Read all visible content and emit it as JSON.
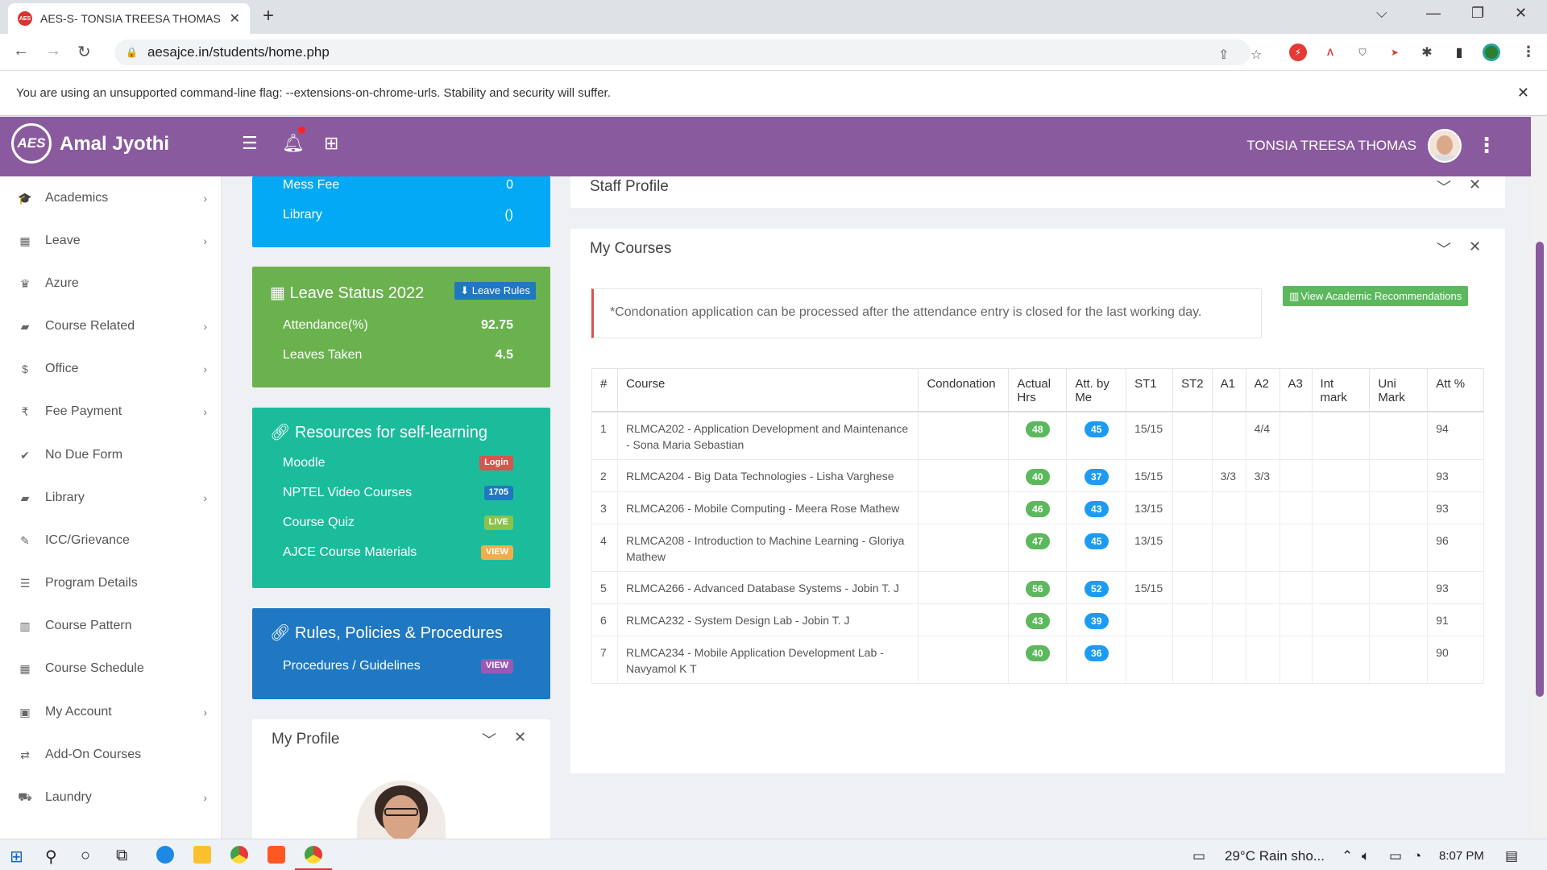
{
  "browser": {
    "tab_title": "AES-S- TONSIA TREESA THOMAS",
    "favicon_text": "AES",
    "url": "aesajce.in/students/home.php",
    "infobar_text": "You are using an unsupported command-line flag: --extensions-on-chrome-urls. Stability and security will suffer."
  },
  "header": {
    "logo_text": "AES",
    "brand": "Amal Jyothi",
    "username": "TONSIA TREESA THOMAS"
  },
  "sidebar": {
    "items": [
      {
        "label": "Academics",
        "icon": "graduation-cap-icon",
        "glyph": "🎓",
        "has_children": true
      },
      {
        "label": "Leave",
        "icon": "calendar-icon",
        "glyph": "▦",
        "has_children": true
      },
      {
        "label": "Azure",
        "icon": "crown-icon",
        "glyph": "♛",
        "has_children": false
      },
      {
        "label": "Course Related",
        "icon": "book-icon",
        "glyph": "▰",
        "has_children": true
      },
      {
        "label": "Office",
        "icon": "dollar-icon",
        "glyph": "$",
        "has_children": true
      },
      {
        "label": "Fee Payment",
        "icon": "rupee-icon",
        "glyph": "₹",
        "has_children": true
      },
      {
        "label": "No Due Form",
        "icon": "check-icon",
        "glyph": "✔",
        "has_children": false
      },
      {
        "label": "Library",
        "icon": "book-icon",
        "glyph": "▰",
        "has_children": true
      },
      {
        "label": "ICC/Grievance",
        "icon": "pencil-icon",
        "glyph": "✎",
        "has_children": false
      },
      {
        "label": "Program Details",
        "icon": "list-icon",
        "glyph": "☰",
        "has_children": false
      },
      {
        "label": "Course Pattern",
        "icon": "bar-chart-icon",
        "glyph": "▥",
        "has_children": false
      },
      {
        "label": "Course Schedule",
        "icon": "calendar-icon",
        "glyph": "▦",
        "has_children": false
      },
      {
        "label": "My Account",
        "icon": "id-card-icon",
        "glyph": "▣",
        "has_children": true
      },
      {
        "label": "Add-On Courses",
        "icon": "shuffle-icon",
        "glyph": "⇄",
        "has_children": false
      },
      {
        "label": "Laundry",
        "icon": "cart-icon",
        "glyph": "⛟",
        "has_children": true
      }
    ]
  },
  "fees": {
    "rows": [
      {
        "label": "Mess Fee",
        "value": "0"
      },
      {
        "label": "Library",
        "value": "()"
      }
    ]
  },
  "leave_status": {
    "title": "Leave Status 2022",
    "rules_button": "Leave Rules",
    "rows": [
      {
        "label": "Attendance(%)",
        "value": "92.75"
      },
      {
        "label": "Leaves Taken",
        "value": "4.5"
      }
    ]
  },
  "resources": {
    "title": "Resources for self-learning",
    "rows": [
      {
        "label": "Moodle",
        "badge": "Login",
        "badge_color": "#d9534f"
      },
      {
        "label": "NPTEL Video Courses",
        "badge": "1705",
        "badge_color": "#1f78c1"
      },
      {
        "label": "Course Quiz",
        "badge": "LIVE",
        "badge_color": "#8bc34a"
      },
      {
        "label": "AJCE Course Materials",
        "badge": "VIEW",
        "badge_color": "#f0ad4e"
      }
    ]
  },
  "rules": {
    "title": "Rules, Policies & Procedures",
    "rows": [
      {
        "label": "Procedures / Guidelines",
        "badge": "VIEW",
        "badge_color": "#9b59b6"
      }
    ]
  },
  "my_profile": {
    "title": "My Profile"
  },
  "staff_profile": {
    "title": "Staff Profile"
  },
  "my_courses": {
    "title": "My Courses",
    "notice": "*Condonation application can be processed after the attendance entry is closed for the last working day.",
    "recommend_button": "View Academic Recommendations",
    "columns": [
      "#",
      "Course",
      "Condonation",
      "Actual Hrs",
      "Att. by Me",
      "ST1",
      "ST2",
      "A1",
      "A2",
      "A3",
      "Int mark",
      "Uni Mark",
      "Att %"
    ],
    "rows": [
      {
        "n": "1",
        "course": "RLMCA202 - Application Development and Maintenance - Sona Maria Sebastian",
        "cond": "",
        "actual": "48",
        "att": "45",
        "st1": "15/15",
        "st2": "",
        "a1": "",
        "a2": "4/4",
        "a3": "",
        "int": "",
        "uni": "",
        "pct": "94"
      },
      {
        "n": "2",
        "course": "RLMCA204 - Big Data Technologies - Lisha Varghese",
        "cond": "",
        "actual": "40",
        "att": "37",
        "st1": "15/15",
        "st2": "",
        "a1": "3/3",
        "a2": "3/3",
        "a3": "",
        "int": "",
        "uni": "",
        "pct": "93"
      },
      {
        "n": "3",
        "course": "RLMCA206 - Mobile Computing - Meera Rose Mathew",
        "cond": "",
        "actual": "46",
        "att": "43",
        "st1": "13/15",
        "st2": "",
        "a1": "",
        "a2": "",
        "a3": "",
        "int": "",
        "uni": "",
        "pct": "93"
      },
      {
        "n": "4",
        "course": "RLMCA208 - Introduction to Machine Learning - Gloriya Mathew",
        "cond": "",
        "actual": "47",
        "att": "45",
        "st1": "13/15",
        "st2": "",
        "a1": "",
        "a2": "",
        "a3": "",
        "int": "",
        "uni": "",
        "pct": "96"
      },
      {
        "n": "5",
        "course": "RLMCA266 - Advanced Database Systems - Jobin T. J",
        "cond": "",
        "actual": "56",
        "att": "52",
        "st1": "15/15",
        "st2": "",
        "a1": "",
        "a2": "",
        "a3": "",
        "int": "",
        "uni": "",
        "pct": "93"
      },
      {
        "n": "6",
        "course": "RLMCA232 - System Design Lab - Jobin T. J",
        "cond": "",
        "actual": "43",
        "att": "39",
        "st1": "",
        "st2": "",
        "a1": "",
        "a2": "",
        "a3": "",
        "int": "",
        "uni": "",
        "pct": "91"
      },
      {
        "n": "7",
        "course": "RLMCA234 - Mobile Application Development Lab - Navyamol K T",
        "cond": "",
        "actual": "40",
        "att": "36",
        "st1": "",
        "st2": "",
        "a1": "",
        "a2": "",
        "a3": "",
        "int": "",
        "uni": "",
        "pct": "90"
      }
    ]
  },
  "taskbar": {
    "weather": "29°C  Rain sho...",
    "time": "8:07 PM"
  }
}
